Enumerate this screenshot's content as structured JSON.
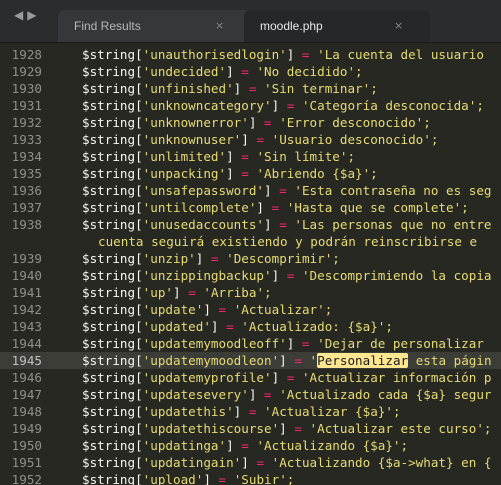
{
  "tabs": [
    {
      "label": "Find Results",
      "close_icon": "×",
      "active": false
    },
    {
      "label": "moodle.php",
      "close_icon": "×",
      "active": true
    }
  ],
  "nav": {
    "back": "◀",
    "forward": "▶"
  },
  "editor": {
    "current_line": "1945",
    "lines": [
      {
        "num": "1928",
        "key": "'unauthorisedlogin'",
        "value": "'La cuenta del usuario"
      },
      {
        "num": "1929",
        "key": "'undecided'",
        "value": "'No decidido';"
      },
      {
        "num": "1930",
        "key": "'unfinished'",
        "value": "'Sin terminar';"
      },
      {
        "num": "1931",
        "key": "'unknowncategory'",
        "value": "'Categoría desconocida';"
      },
      {
        "num": "1932",
        "key": "'unknownerror'",
        "value": "'Error desconocido';"
      },
      {
        "num": "1933",
        "key": "'unknownuser'",
        "value": "'Usuario desconocido';"
      },
      {
        "num": "1934",
        "key": "'unlimited'",
        "value": "'Sin límite';"
      },
      {
        "num": "1935",
        "key": "'unpacking'",
        "value": "'Abriendo {$a}';"
      },
      {
        "num": "1936",
        "key": "'unsafepassword'",
        "value": "'Esta contraseña no es seg"
      },
      {
        "num": "1937",
        "key": "'untilcomplete'",
        "value": "'Hasta que se complete';"
      },
      {
        "num": "1938",
        "key": "'unusedaccounts'",
        "value": "'Las personas que no entre"
      },
      {
        "num": "",
        "continuation": "cuenta seguirá existiendo y podrán reinscribirse e"
      },
      {
        "num": "1939",
        "key": "'unzip'",
        "value": "'Descomprimir';"
      },
      {
        "num": "1940",
        "key": "'unzippingbackup'",
        "value": "'Descomprimiendo la copia"
      },
      {
        "num": "1941",
        "key": "'up'",
        "value": "'Arriba';"
      },
      {
        "num": "1942",
        "key": "'update'",
        "value": "'Actualizar';"
      },
      {
        "num": "1943",
        "key": "'updated'",
        "value": "'Actualizado: {$a}';"
      },
      {
        "num": "1944",
        "key": "'updatemymoodleoff'",
        "value": "'Dejar de personalizar"
      },
      {
        "num": "1945",
        "key": "'updatemymoodleon'",
        "value_pre": "'",
        "highlight": "Personalizar",
        "value_post": " esta págin"
      },
      {
        "num": "1946",
        "key": "'updatemyprofile'",
        "value": "'Actualizar información p"
      },
      {
        "num": "1947",
        "key": "'updatesevery'",
        "value": "'Actualizado cada {$a} segur"
      },
      {
        "num": "1948",
        "key": "'updatethis'",
        "value": "'Actualizar {$a}';"
      },
      {
        "num": "1949",
        "key": "'updatethiscourse'",
        "value": "'Actualizar este curso';"
      },
      {
        "num": "1950",
        "key": "'updatinga'",
        "value": "'Actualizando {$a}';"
      },
      {
        "num": "1951",
        "key": "'updatingain'",
        "value": "'Actualizando {$a->what} en {"
      },
      {
        "num": "1952",
        "key": "'upload'",
        "value": "'Subir';"
      }
    ]
  }
}
